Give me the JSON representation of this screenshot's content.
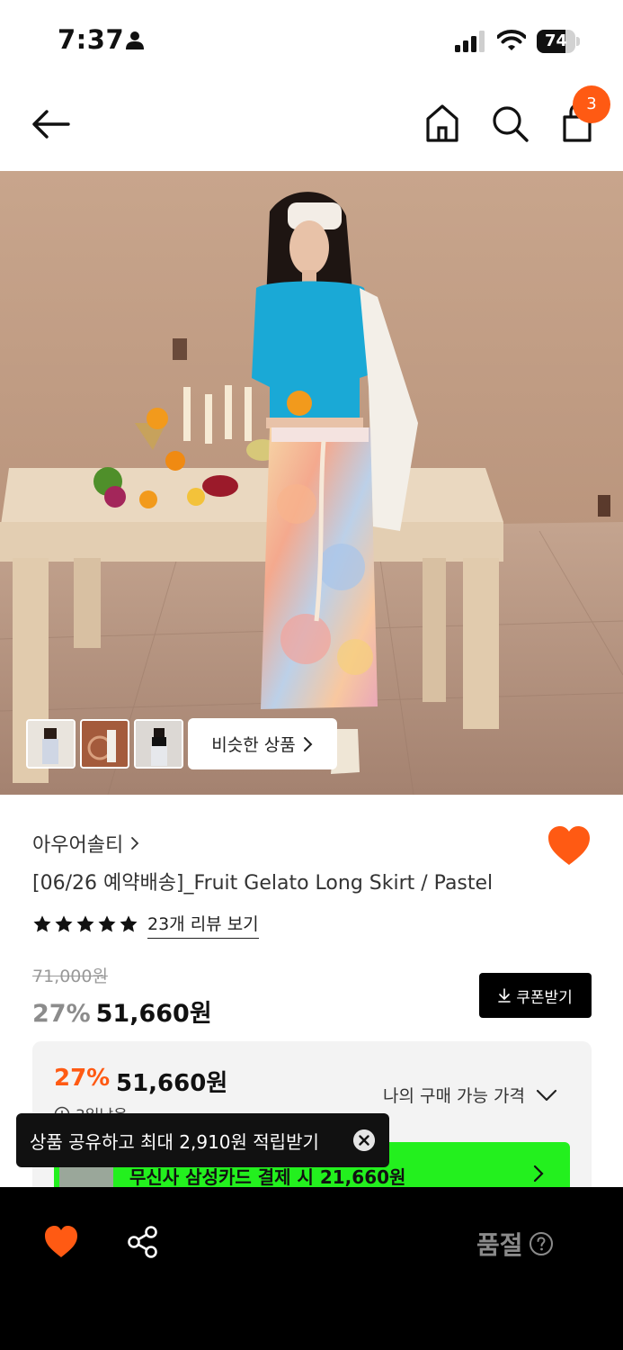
{
  "status_bar": {
    "time": "7:37",
    "battery": "74",
    "battery_level": 0.74,
    "icons": [
      "person-icon",
      "signal-icon",
      "wifi-icon",
      "battery-icon"
    ]
  },
  "nav": {
    "icons": [
      "back-arrow-icon",
      "home-icon",
      "search-icon",
      "cart-icon"
    ],
    "cart_count": "3"
  },
  "gallery": {
    "similar_label": "비슷한 상품",
    "thumbnail_count": 3
  },
  "product": {
    "brand": "아우어솔티",
    "title": "[06/26 예약배송]_Fruit Gelato Long Skirt / Pastel",
    "rating_stars": 5,
    "review_link": "23개 리뷰 보기",
    "original_price": "71,000원",
    "discount": "27%",
    "price": "51,660원",
    "coupon_label": "쿠폰받기"
  },
  "purchase_box": {
    "discount": "27%",
    "price": "51,660원",
    "sub_text": "3일남음",
    "toggle_label": "나의 구매 가능 가격",
    "card_banner": "무신사 삼성카드 결제 시 21,660원"
  },
  "tooltip": {
    "text": "상품 공유하고 최대 2,910원 적립받기"
  },
  "bottom_bar": {
    "soldout_label": "품절"
  },
  "colors": {
    "accent": "#ff5a13",
    "card_green": "#23f01e",
    "bottom_bar": "#000000"
  }
}
